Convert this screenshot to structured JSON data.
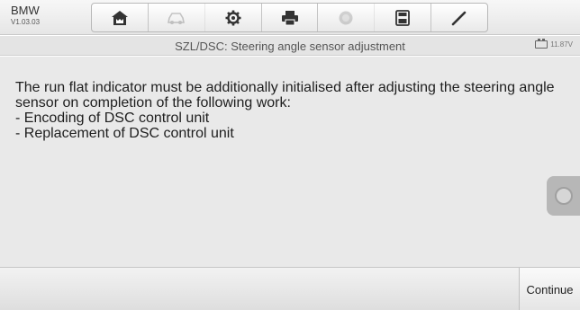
{
  "header": {
    "brand": "BMW",
    "version": "V1.03.03",
    "toolbar": [
      {
        "name": "home-icon",
        "enabled": true
      },
      {
        "name": "vehicle-swap-icon",
        "enabled": false
      },
      {
        "name": "gear-icon",
        "enabled": true
      },
      {
        "name": "printer-icon",
        "enabled": true
      },
      {
        "name": "help-icon",
        "enabled": false
      },
      {
        "name": "save-icon",
        "enabled": true
      },
      {
        "name": "pen-icon",
        "enabled": true
      }
    ]
  },
  "titlebar": {
    "title": "SZL/DSC: Steering angle sensor adjustment",
    "battery_voltage": "11.87V"
  },
  "main": {
    "lines": [
      "The run flat indicator must be additionally initialised after adjusting the steering angle",
      "sensor on completion of the following work:",
      "- Encoding of DSC control unit",
      "- Replacement of DSC control unit"
    ]
  },
  "footer": {
    "continue_label": "Continue"
  },
  "colors": {
    "content_bg": "#e9e9e9",
    "title_bg": "#e4e4e4",
    "text": "#1e1e1e"
  }
}
